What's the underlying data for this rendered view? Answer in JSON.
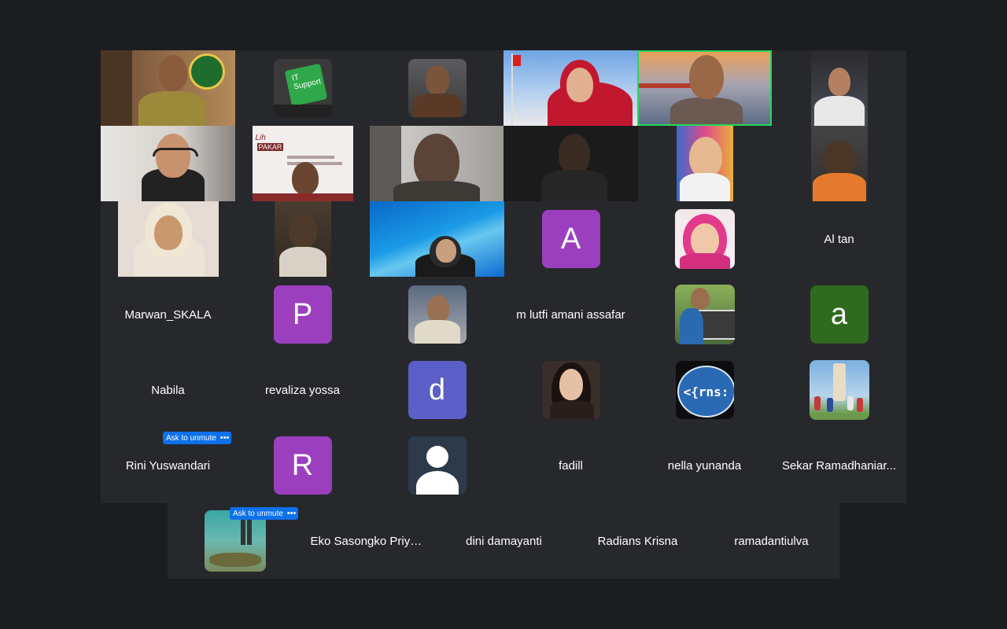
{
  "grid": {
    "row1": {
      "t1": {
        "name": ""
      },
      "t2": {
        "icon_text_1": "IT",
        "icon_text_2": "Support"
      },
      "t3": {
        "name": ""
      },
      "t4": {
        "name": ""
      },
      "t5": {
        "name": ""
      },
      "t6": {
        "name": ""
      }
    },
    "row2": {
      "t2": {
        "slide_line1": "Lih",
        "slide_line2": "PAKAR"
      }
    },
    "row3": {
      "avatar_a": "A",
      "al_tan": "Al tan"
    },
    "row4": {
      "marwan": "Marwan_SKALA",
      "avatar_p": "P",
      "lutfi": "m lutfi amani assafar",
      "avatar_a_small": "a"
    },
    "row5": {
      "nabila": "Nabila",
      "revaliza": "revaliza yossa",
      "avatar_d": "d",
      "rns_logo": "<{rns:"
    },
    "row6": {
      "rini": "Rini Yuswandari",
      "avatar_r": "R",
      "fadill": "fadill",
      "nella": "nella yunanda",
      "sekar": "Sekar Ramadhaniar..."
    },
    "row7": {
      "eko": "Eko Sasongko Priyad...",
      "dini": "dini damayanti",
      "radians": "Radians Krisna",
      "ramadanti": "ramadantiulva"
    }
  },
  "controls": {
    "ask_to_unmute": "Ask to unmute",
    "more": "•••"
  },
  "colors": {
    "background": "#1c1d21",
    "tile_bg": "#27282c",
    "active_border": "#23d959",
    "purple_avatar": "#9b3fbf",
    "green_avatar": "#2f6b1e",
    "blue_avatar": "#5b5fc7",
    "button_blue": "#0e71eb"
  }
}
